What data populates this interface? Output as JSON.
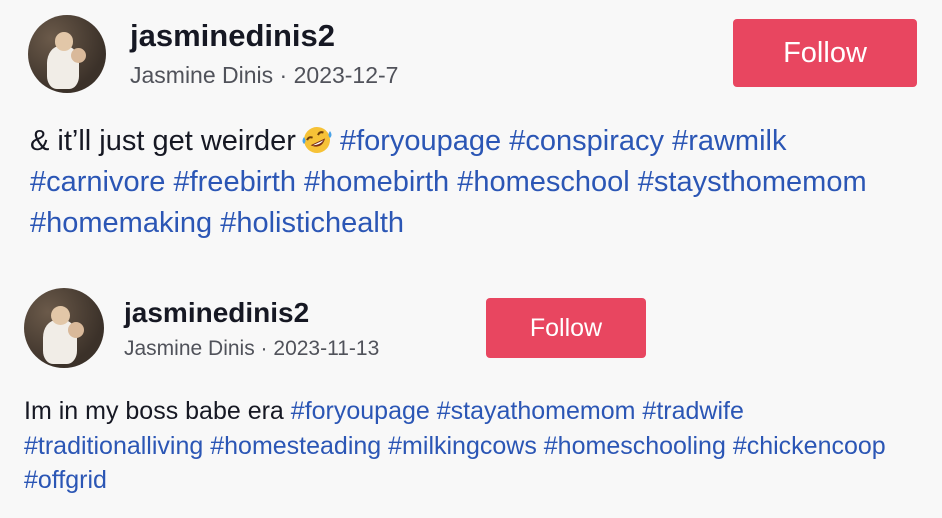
{
  "posts": [
    {
      "username": "jasminedinis2",
      "display_name": "Jasmine Dinis",
      "separator": " · ",
      "date": "2023-12-7",
      "follow_label": "Follow",
      "caption_text": "& it’ll just get weirder",
      "emoji": "rolling-on-floor-laughing",
      "hashtags": [
        "#foryoupage",
        "#conspiracy",
        "#rawmilk",
        "#carnivore",
        "#freebirth",
        "#homebirth",
        "#homeschool",
        "#staysthomemom",
        "#homemaking",
        "#holistichealth"
      ]
    },
    {
      "username": "jasminedinis2",
      "display_name": "Jasmine Dinis",
      "separator": " · ",
      "date": "2023-11-13",
      "follow_label": "Follow",
      "caption_text": "Im in my boss babe era",
      "hashtags": [
        "#foryoupage",
        "#stayathomemom",
        "#tradwife",
        "#traditionalliving",
        "#homesteading",
        "#milkingcows",
        "#homeschooling",
        "#chickencoop",
        "#offgrid"
      ]
    }
  ],
  "colors": {
    "follow_bg": "#e84660",
    "hashtag": "#2b56b5",
    "background": "#f8f8f8",
    "meta_text": "#50525a"
  }
}
